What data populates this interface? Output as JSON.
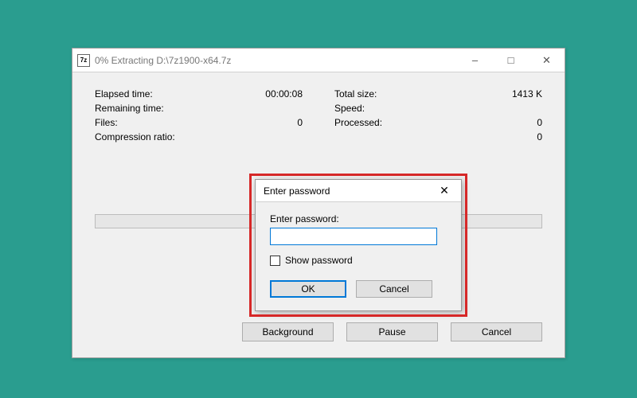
{
  "window": {
    "icon_text": "7z",
    "title": "0% Extracting D:\\7z1900-x64.7z"
  },
  "stats": {
    "elapsed_label": "Elapsed time:",
    "elapsed_value": "00:00:08",
    "remaining_label": "Remaining time:",
    "remaining_value": "",
    "files_label": "Files:",
    "files_value": "0",
    "compression_label": "Compression ratio:",
    "compression_value": "",
    "totalsize_label": "Total size:",
    "totalsize_value": "1413 K",
    "speed_label": "Speed:",
    "speed_value": "",
    "processed_label": "Processed:",
    "processed_value": "0",
    "row4_right_value": "0"
  },
  "buttons": {
    "background": "Background",
    "pause": "Pause",
    "cancel": "Cancel"
  },
  "dialog": {
    "title": "Enter password",
    "field_label": "Enter password:",
    "input_value": "",
    "show_password_label": "Show password",
    "ok": "OK",
    "cancel": "Cancel"
  }
}
